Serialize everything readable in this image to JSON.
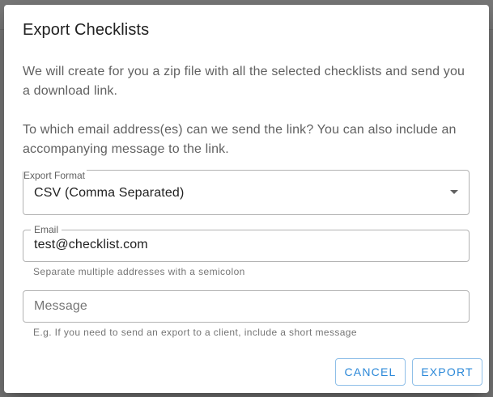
{
  "dialog": {
    "title": "Export Checklists",
    "intro_text": "We will create for you a zip file with all the selected checklists and send you a download link.",
    "email_prompt": "To which email address(es) can we send the link? You can also include an accompanying message to the link."
  },
  "export_format": {
    "label": "Export Format",
    "selected": "CSV (Comma Separated)"
  },
  "email": {
    "label": "Email",
    "value": "test@checklist.com",
    "helper": "Separate multiple addresses with a semicolon"
  },
  "message": {
    "placeholder": "Message",
    "helper": "E.g. If you need to send an export to a client, include a short message"
  },
  "actions": {
    "cancel_label": "CANCEL",
    "export_label": "EXPORT"
  },
  "colors": {
    "accent": "#2b88d8",
    "backdrop": "#7a7a7a"
  }
}
